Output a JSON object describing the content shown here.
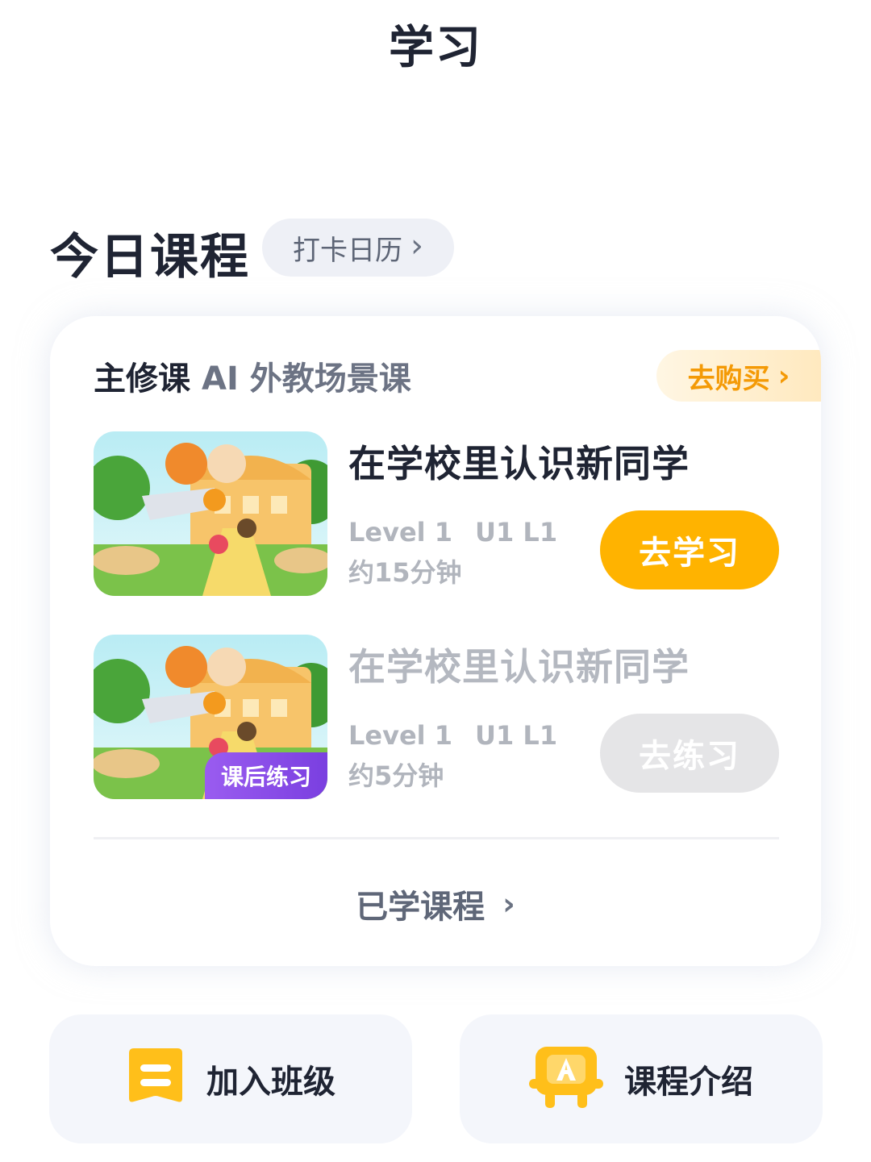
{
  "header": {
    "title": "学习"
  },
  "today": {
    "section_title": "今日课程",
    "calendar_label": "打卡日历",
    "calendar_chevron": "›"
  },
  "card": {
    "main_label": "主修课",
    "sub_label": "AI 外教场景课",
    "buy_label": "去购买",
    "buy_chevron": "›",
    "lessons": [
      {
        "title": "在学校里认识新同学",
        "level": "Level 1",
        "unit": "U1 L1",
        "duration": "约15分钟",
        "action": "去学习",
        "badge": ""
      },
      {
        "title": "在学校里认识新同学",
        "level": "Level 1",
        "unit": "U1 L1",
        "duration": "约5分钟",
        "action": "去练习",
        "badge": "课后练习"
      }
    ],
    "learned_label": "已学课程",
    "learned_chevron": "›"
  },
  "tiles": [
    {
      "label": "加入班级",
      "icon": "class-icon"
    },
    {
      "label": "课程介绍",
      "icon": "course-intro-icon"
    }
  ],
  "colors": {
    "accent_orange": "#ffb300",
    "buy_text": "#f49a06",
    "badge_purple": "#8b4cea",
    "disabled_btn": "#e5e5e7"
  }
}
